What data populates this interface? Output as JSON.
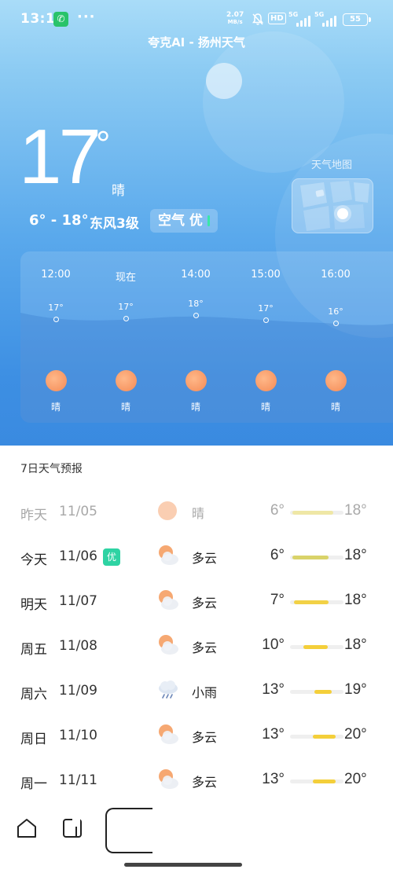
{
  "status_bar": {
    "time": "13:16",
    "more": "···",
    "net_speed_value": "2.07",
    "net_speed_unit": "MB/s",
    "hd": "HD",
    "signal_label_1": "5G",
    "signal_label_2": "5G",
    "battery": "55"
  },
  "header": {
    "title": "夸克AI - 扬州天气"
  },
  "current": {
    "temperature": "17",
    "degree": "°",
    "condition": "晴",
    "range": "6° - 18°",
    "wind": "东风3级",
    "air_quality": "空气 优"
  },
  "map": {
    "label": "天气地图"
  },
  "hourly": [
    {
      "time": "12:00",
      "temp": "17°",
      "condition": "晴"
    },
    {
      "time": "现在",
      "temp": "17°",
      "condition": "晴"
    },
    {
      "time": "14:00",
      "temp": "18°",
      "condition": "晴"
    },
    {
      "time": "15:00",
      "temp": "17°",
      "condition": "晴"
    },
    {
      "time": "16:00",
      "temp": "16°",
      "condition": "晴"
    }
  ],
  "forecast": {
    "title": "7日天气预报",
    "days": [
      {
        "day": "昨天",
        "date": "11/05",
        "condition": "晴",
        "icon": "sun-icon",
        "low": "6°",
        "high": "18°",
        "badge": ""
      },
      {
        "day": "今天",
        "date": "11/06",
        "condition": "多云",
        "icon": "partly-cloudy-icon",
        "low": "6°",
        "high": "18°",
        "badge": "优"
      },
      {
        "day": "明天",
        "date": "11/07",
        "condition": "多云",
        "icon": "partly-cloudy-icon",
        "low": "7°",
        "high": "18°",
        "badge": ""
      },
      {
        "day": "周五",
        "date": "11/08",
        "condition": "多云",
        "icon": "partly-cloudy-icon",
        "low": "10°",
        "high": "18°",
        "badge": ""
      },
      {
        "day": "周六",
        "date": "11/09",
        "condition": "小雨",
        "icon": "rain-icon",
        "low": "13°",
        "high": "19°",
        "badge": ""
      },
      {
        "day": "周日",
        "date": "11/10",
        "condition": "多云",
        "icon": "partly-cloudy-icon",
        "low": "13°",
        "high": "20°",
        "badge": ""
      },
      {
        "day": "周一",
        "date": "11/11",
        "condition": "多云",
        "icon": "partly-cloudy-icon",
        "low": "13°",
        "high": "20°",
        "badge": ""
      }
    ]
  },
  "nav": {
    "items": [
      "home-icon",
      "tabs-icon",
      "recents-icon"
    ]
  },
  "colors": {
    "sky_top": "#a9dcf8",
    "sky_bottom": "#3a8ae0",
    "sun": "#f48a55",
    "badge_green": "#2ed3a3",
    "temp_bar": "#f4cf3a"
  }
}
